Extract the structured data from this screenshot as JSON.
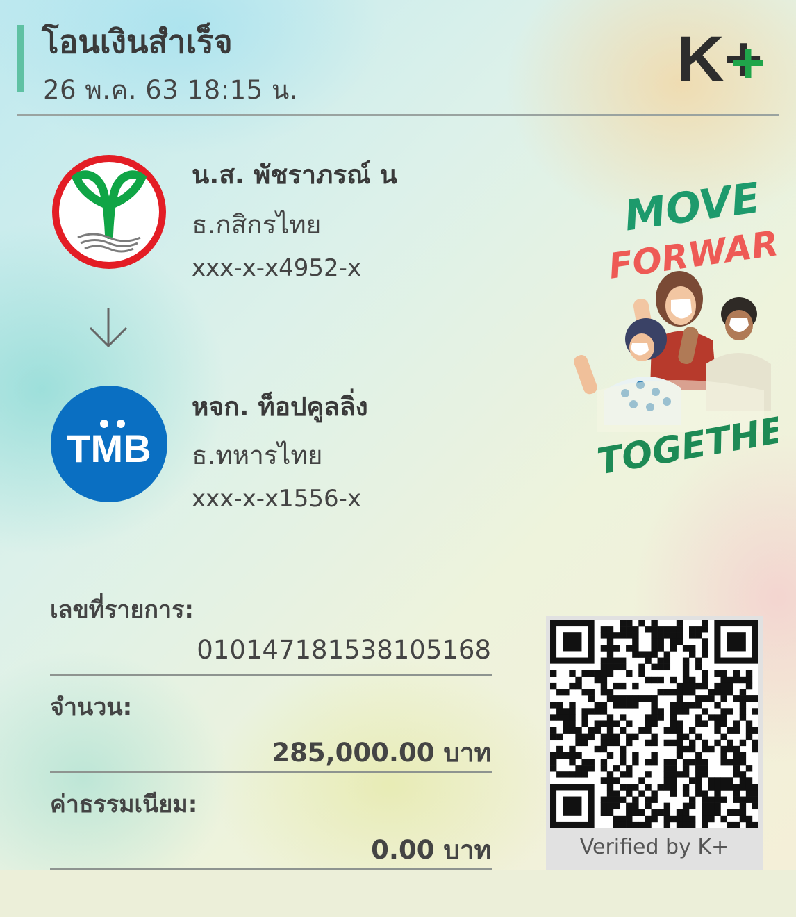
{
  "header": {
    "title": "โอนเงินสำเร็จ",
    "datetime": "26 พ.ค. 63  18:15 น.",
    "app_logo": "K+",
    "accent_color": "#5fc1a3"
  },
  "sender": {
    "name": "น.ส. พัชราภรณ์ น",
    "bank": "ธ.กสิกรไทย",
    "account": "xxx-x-x4952-x",
    "logo_icon": "kasikorn-bank-logo"
  },
  "transfer_arrow_icon": "arrow-down-icon",
  "receiver": {
    "name": "หจก. ท็อปคูลลิ่ง",
    "bank": "ธ.ทหารไทย",
    "account": "xxx-x-x1556-x",
    "logo_text": "TMB",
    "logo_icon": "tmb-bank-logo",
    "logo_color": "#0a6fc2"
  },
  "promo": {
    "line1": "MOVE",
    "line2": "FORWARD",
    "line3": "TOGETHER"
  },
  "details": {
    "transaction_label": "เลขที่รายการ:",
    "transaction_id": "010147181538105168",
    "amount_label": "จำนวน:",
    "amount": "285,000.00 บาท",
    "fee_label": "ค่าธรรมเนียม:",
    "fee": "0.00 บาท"
  },
  "qr": {
    "caption": "Verified by K+",
    "icon": "qr-code-icon"
  }
}
